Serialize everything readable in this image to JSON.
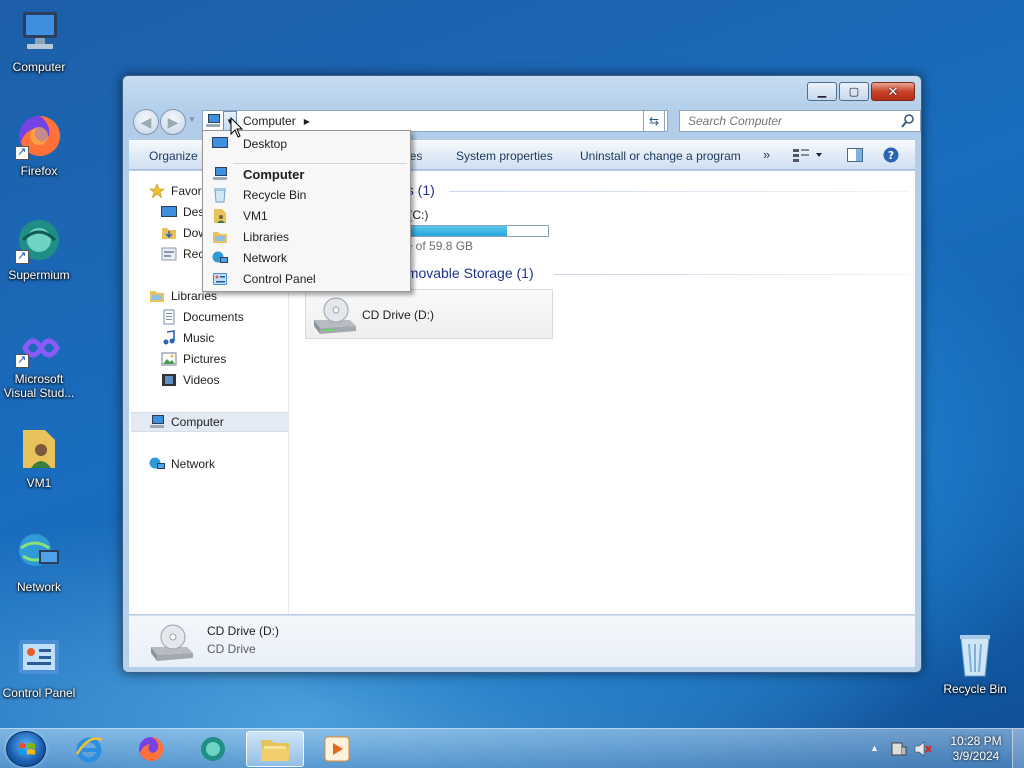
{
  "desktop": {
    "icons": [
      {
        "label": "Computer"
      },
      {
        "label": "Firefox"
      },
      {
        "label": "Supermium"
      },
      {
        "label": "Microsoft Visual Stud..."
      },
      {
        "label": "VM1"
      },
      {
        "label": "Network"
      },
      {
        "label": "Control Panel"
      },
      {
        "label": "Recycle Bin"
      }
    ]
  },
  "window": {
    "address": {
      "current": "Computer"
    },
    "search": {
      "placeholder": "Search Computer"
    },
    "toolbar": {
      "organize": "Organize",
      "properties_partial": "ies",
      "system_properties": "System properties",
      "uninstall": "Uninstall or change a program",
      "more": "»"
    },
    "navpane": {
      "favorites": "Favori",
      "desktop": "Desk",
      "downloads": "Dow",
      "recent": "Rece",
      "libraries": "Libraries",
      "documents": "Documents",
      "music": "Music",
      "pictures": "Pictures",
      "videos": "Videos",
      "computer": "Computer",
      "network": "Network"
    },
    "content": {
      "hard_disk_header": "es (1)",
      "local_disk": "k (C:)",
      "free_space": "ee of 59.8 GB",
      "used_fraction": 0.72,
      "removable_header": "emovable Storage (1)",
      "cd_drive": "CD Drive (D:)"
    },
    "details": {
      "name": "CD Drive (D:)",
      "type": "CD Drive"
    }
  },
  "menu": {
    "items": [
      {
        "label": "Desktop"
      },
      {
        "label": "Computer"
      },
      {
        "label": "Recycle Bin"
      },
      {
        "label": "VM1"
      },
      {
        "label": "Libraries"
      },
      {
        "label": "Network"
      },
      {
        "label": "Control Panel"
      }
    ]
  },
  "taskbar": {
    "clock": {
      "time": "10:28 PM",
      "date": "3/9/2024"
    }
  },
  "colors": {
    "accent": "#1e3287",
    "progress": "#27a4de",
    "close": "#c8452b"
  }
}
